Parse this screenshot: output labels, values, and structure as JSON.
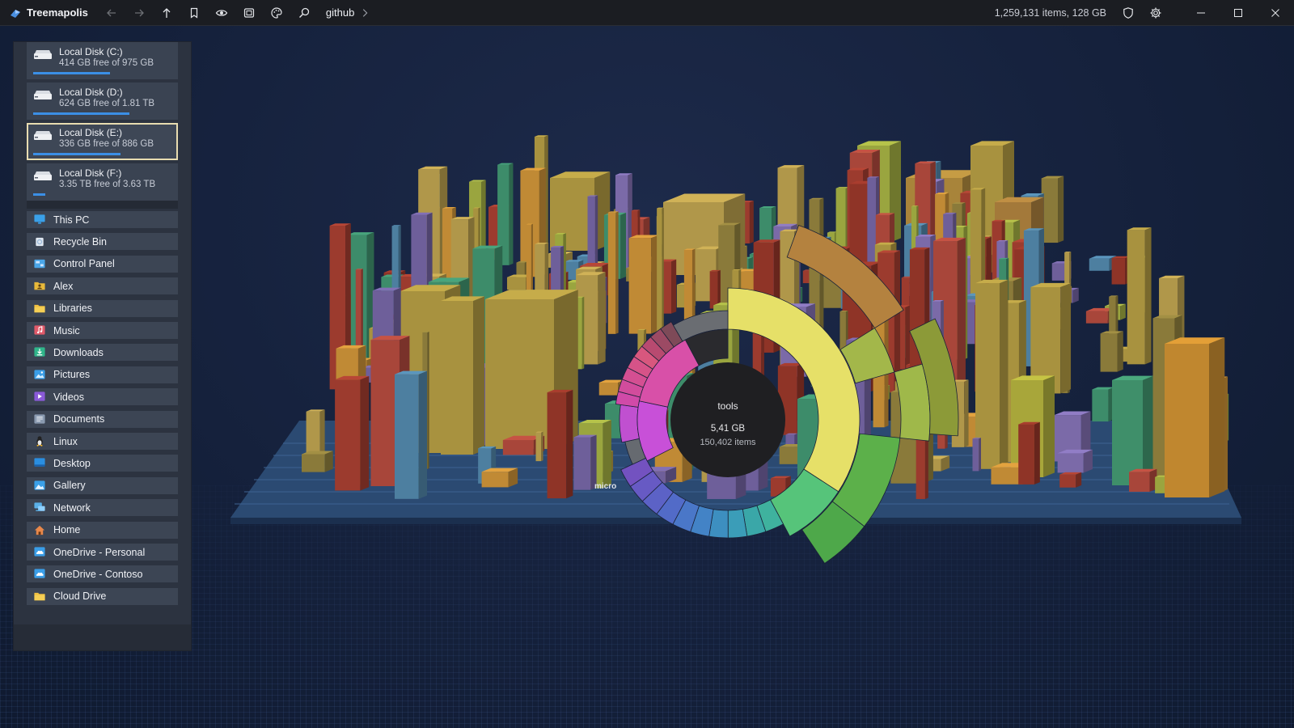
{
  "app": {
    "title": "Treemapolis"
  },
  "toolbar": {
    "breadcrumb": "github",
    "status": "1,259,131 items, 128 GB"
  },
  "drives": [
    {
      "name": "Local Disk (C:)",
      "free": "414 GB free of 975 GB",
      "used_fraction": 0.52,
      "selected": false
    },
    {
      "name": "Local Disk (D:)",
      "free": "624 GB free of 1.81 TB",
      "used_fraction": 0.65,
      "selected": false
    },
    {
      "name": "Local Disk (E:)",
      "free": "336 GB free of 886 GB",
      "used_fraction": 0.59,
      "selected": true
    },
    {
      "name": "Local Disk (F:)",
      "free": "3.35 TB free of 3.63 TB",
      "used_fraction": 0.08,
      "selected": false
    }
  ],
  "places": [
    {
      "label": "This PC",
      "icon": "monitor-icon",
      "color": "#3aa0e8"
    },
    {
      "label": "Recycle Bin",
      "icon": "recycle-bin-icon",
      "color": "#9ab8d8"
    },
    {
      "label": "Control Panel",
      "icon": "control-panel-icon",
      "color": "#4aa6e8"
    },
    {
      "label": "Alex",
      "icon": "user-folder-icon",
      "color": "#e8b93a"
    },
    {
      "label": "Libraries",
      "icon": "folder-icon",
      "color": "#f0c040"
    },
    {
      "label": "Music",
      "icon": "music-icon",
      "color": "#e05a6a"
    },
    {
      "label": "Downloads",
      "icon": "downloads-icon",
      "color": "#2fb58a"
    },
    {
      "label": "Pictures",
      "icon": "pictures-icon",
      "color": "#3a9ee8"
    },
    {
      "label": "Videos",
      "icon": "videos-icon",
      "color": "#8a5ad8"
    },
    {
      "label": "Documents",
      "icon": "documents-icon",
      "color": "#8a9ab0"
    },
    {
      "label": "Linux",
      "icon": "linux-icon",
      "color": "#e8e8e8"
    },
    {
      "label": "Desktop",
      "icon": "desktop-icon",
      "color": "#2a8ee0"
    },
    {
      "label": "Gallery",
      "icon": "gallery-icon",
      "color": "#3aa0e8"
    },
    {
      "label": "Network",
      "icon": "network-icon",
      "color": "#5ab0e8"
    },
    {
      "label": "Home",
      "icon": "home-icon",
      "color": "#e8884a"
    },
    {
      "label": "OneDrive - Personal",
      "icon": "onedrive-icon",
      "color": "#3a9ee8"
    },
    {
      "label": "OneDrive - Contoso",
      "icon": "onedrive-icon",
      "color": "#3a9ee8"
    },
    {
      "label": "Cloud Drive",
      "icon": "folder-icon",
      "color": "#f0c040"
    }
  ],
  "sunburst": {
    "name": "tools",
    "size": "5,41 GB",
    "items": "150,402 items"
  },
  "city": {
    "district_label": "micro"
  }
}
